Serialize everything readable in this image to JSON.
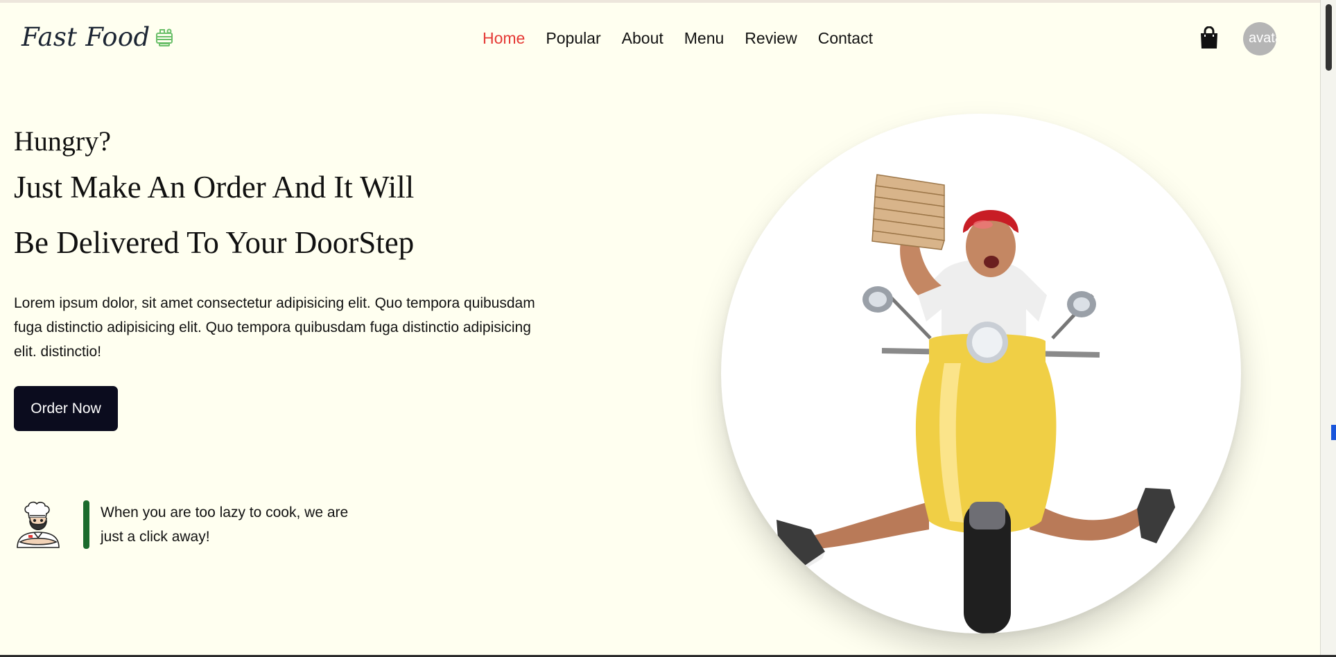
{
  "brand": {
    "name": "Fast Food",
    "icon": "burger-icon",
    "icon_color": "#6abf69"
  },
  "nav": {
    "items": [
      {
        "label": "Home",
        "active": true
      },
      {
        "label": "Popular",
        "active": false
      },
      {
        "label": "About",
        "active": false
      },
      {
        "label": "Menu",
        "active": false
      },
      {
        "label": "Review",
        "active": false
      },
      {
        "label": "Contact",
        "active": false
      }
    ],
    "active_color": "#e53935"
  },
  "header_actions": {
    "cart_icon": "shopping-bag-icon",
    "avatar_alt": "avatar"
  },
  "hero": {
    "kicker": "Hungry?",
    "headline_line1": "Just Make An Order And It Will",
    "headline_line2": "Be Delivered To Your DoorStep",
    "body": "Lorem ipsum dolor, sit amet consectetur adipisicing elit. Quo tempora quibusdam fuga distinctio adipisicing elit. Quo tempora quibusdam fuga distinctio adipisicing elit. distinctio!",
    "cta_label": "Order Now",
    "image": "delivery-man-on-yellow-scooter-with-pizza-boxes"
  },
  "tagline": {
    "icon": "chef-icon",
    "text": "When you are too lazy to cook, we are just a click away!",
    "accent_color": "#1b6b2c"
  },
  "colors": {
    "background": "#fffff0",
    "button": "#0b0c1e",
    "text": "#111111"
  }
}
